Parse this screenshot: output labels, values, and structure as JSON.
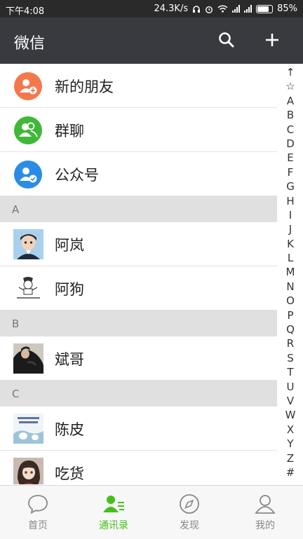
{
  "status_bar": {
    "time": "下午4:08",
    "speed": "24.3K/s",
    "battery": "85%"
  },
  "header": {
    "title": "微信",
    "search_icon": "search-icon",
    "add_icon": "plus-icon"
  },
  "shortcuts": [
    {
      "label": "新的朋友",
      "icon": "new-friend-icon",
      "color": "#f5784d"
    },
    {
      "label": "群聊",
      "icon": "group-chat-icon",
      "color": "#3fb838"
    },
    {
      "label": "公众号",
      "icon": "official-account-icon",
      "color": "#2b8ce5"
    }
  ],
  "sections": [
    {
      "letter": "A",
      "contacts": [
        "阿岚",
        "阿狗"
      ]
    },
    {
      "letter": "B",
      "contacts": [
        "斌哥"
      ]
    },
    {
      "letter": "C",
      "contacts": [
        "陈皮",
        "吃货"
      ]
    }
  ],
  "index_letters": [
    "↑",
    "☆",
    "A",
    "B",
    "C",
    "D",
    "E",
    "F",
    "G",
    "H",
    "I",
    "J",
    "K",
    "L",
    "M",
    "N",
    "O",
    "P",
    "Q",
    "R",
    "S",
    "T",
    "U",
    "V",
    "W",
    "X",
    "Y",
    "Z",
    "#"
  ],
  "bottom_nav": [
    {
      "label": "首页",
      "icon": "chat-bubble-icon",
      "active": false
    },
    {
      "label": "通讯录",
      "icon": "contacts-icon",
      "active": true
    },
    {
      "label": "发现",
      "icon": "compass-icon",
      "active": false
    },
    {
      "label": "我的",
      "icon": "person-icon",
      "active": false
    }
  ],
  "colors": {
    "accent": "#45c01a",
    "topbar": "#393a3f",
    "section_bg": "#e0e0e0"
  }
}
